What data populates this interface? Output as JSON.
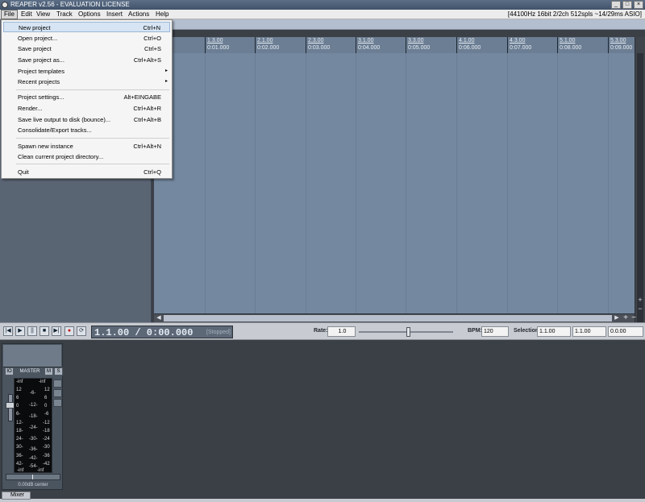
{
  "titlebar": {
    "title": "REAPER v2.56 - EVALUATION LICENSE",
    "minimize": "_",
    "maximize": "□",
    "close": "×"
  },
  "menubar": {
    "items": [
      "File",
      "Edit",
      "View",
      "Track",
      "Options",
      "Insert",
      "Actions",
      "Help"
    ],
    "status": "[44100Hz 16bit 2/2ch 512spls ~14/29ms ASIO]"
  },
  "file_menu": [
    {
      "label": "New project",
      "shortcut": "Ctrl+N"
    },
    {
      "label": "Open project...",
      "shortcut": "Ctrl+O"
    },
    {
      "label": "Save project",
      "shortcut": "Ctrl+S"
    },
    {
      "label": "Save project as...",
      "shortcut": "Ctrl+Alt+S"
    },
    {
      "label": "Project templates",
      "shortcut": "",
      "submenu": "▸"
    },
    {
      "label": "Recent projects",
      "shortcut": "",
      "submenu": "▸"
    },
    {
      "label": "Project settings...",
      "shortcut": "Alt+EINGABE"
    },
    {
      "label": "Render...",
      "shortcut": "Ctrl+Alt+R"
    },
    {
      "label": "Save live output to disk (bounce)...",
      "shortcut": "Ctrl+Alt+B"
    },
    {
      "label": "Consolidate/Export tracks...",
      "shortcut": ""
    },
    {
      "label": "Spawn new instance",
      "shortcut": "Ctrl+Alt+N"
    },
    {
      "label": "Clean current project directory...",
      "shortcut": ""
    },
    {
      "label": "Quit",
      "shortcut": "Ctrl+Q"
    }
  ],
  "ruler": {
    "ticks": [
      {
        "bar": "1.3.00",
        "time": "0:01.000"
      },
      {
        "bar": "2.1.00",
        "time": "0:02.000"
      },
      {
        "bar": "2.3.00",
        "time": "0:03.000"
      },
      {
        "bar": "3.1.00",
        "time": "0:04.000"
      },
      {
        "bar": "3.3.00",
        "time": "0:05.000"
      },
      {
        "bar": "4.1.00",
        "time": "0:06.000"
      },
      {
        "bar": "4.3.00",
        "time": "0:07.000"
      },
      {
        "bar": "5.1.00",
        "time": "0:08.000"
      },
      {
        "bar": "5.3.00",
        "time": "0:09.000"
      }
    ]
  },
  "scroll": {
    "left": "◀",
    "right": "▶",
    "up": "▲",
    "down": "▼",
    "zoom_in": "+",
    "zoom_out": "−"
  },
  "transport": {
    "position": "1.1.00 / 0:00.000",
    "state": "[Stopped]",
    "rate_label": "Rate:",
    "rate_value": "1.0",
    "bpm_label": "BPM:",
    "bpm_value": "120",
    "selection_label": "Selection:",
    "sel_start": "1.1.00",
    "sel_end": "1.1.00",
    "sel_length": "0.0.00",
    "buttons": [
      "|◀",
      "▶",
      "||",
      "■",
      "▶|",
      "●",
      "⟳"
    ]
  },
  "master": {
    "name": "MASTER",
    "mute": "M",
    "solo": "S",
    "io": "IO",
    "peak_l": "-inf",
    "peak_r": "-inf",
    "scale_left": [
      "12",
      "6",
      "0",
      "6-",
      "12-",
      "18-",
      "24-",
      "30-",
      "36-",
      "42-"
    ],
    "scale_center": [
      "-6-",
      "-12-",
      "-18-",
      "-24-",
      "-30-",
      "-36-",
      "-42-",
      "-54-"
    ],
    "scale_right": [
      "12",
      "6",
      "0",
      "-6",
      "-12",
      "-18",
      "-24",
      "-30",
      "-36",
      "-42"
    ],
    "foot_l": "-inf",
    "foot_r": "-inf",
    "volume": "0.00dB center"
  },
  "mixer_tab": "Mixer"
}
